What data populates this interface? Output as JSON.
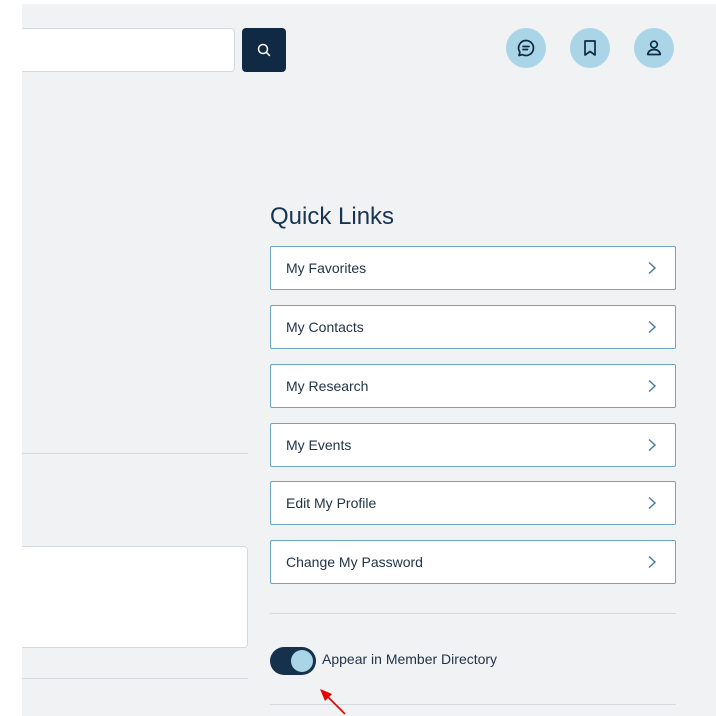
{
  "header": {
    "search_placeholder": "",
    "icons": {
      "search": "search-icon",
      "messages": "chat-icon",
      "bookmarks": "bookmark-icon",
      "profile": "user-icon"
    }
  },
  "quick_links": {
    "title": "Quick Links",
    "items": [
      {
        "label": "My Favorites"
      },
      {
        "label": "My Contacts"
      },
      {
        "label": "My Research"
      },
      {
        "label": "My Events"
      },
      {
        "label": "Edit My Profile"
      },
      {
        "label": "Change My Password"
      }
    ]
  },
  "directory_toggle": {
    "label": "Appear in Member Directory",
    "checked": true
  },
  "colors": {
    "accent_dark": "#102a43",
    "accent_light": "#a9d5e6",
    "link_border": "#6ba7c0",
    "annotation_arrow": "#e60000"
  }
}
